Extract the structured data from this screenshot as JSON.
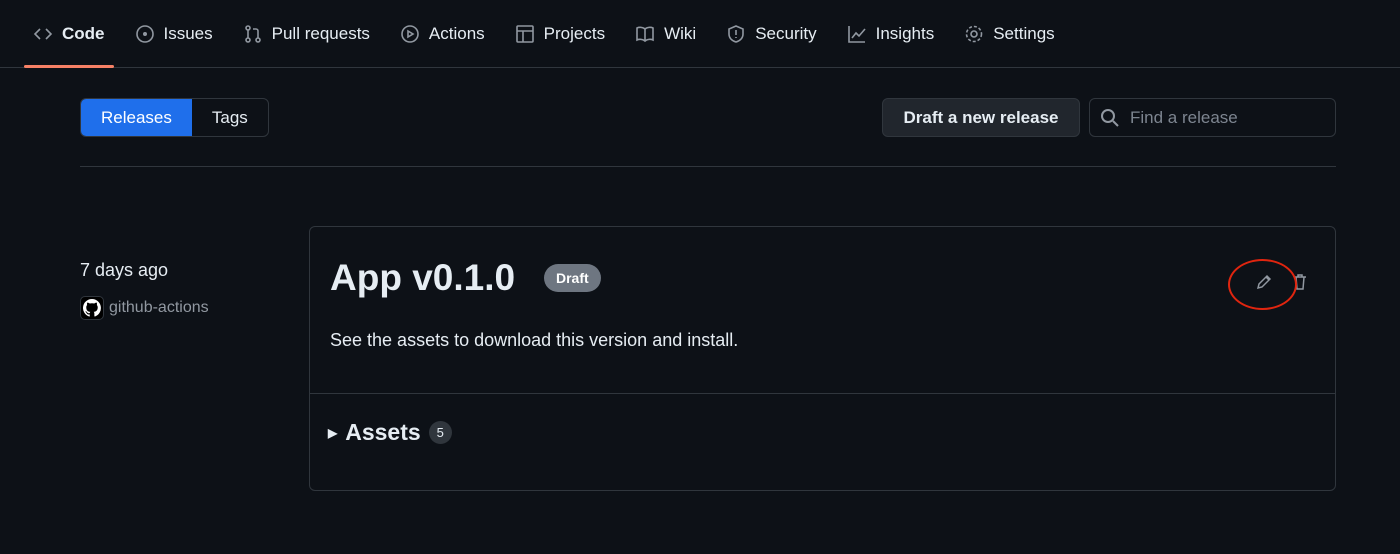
{
  "nav": {
    "tabs": [
      {
        "label": "Code",
        "icon": "code-icon"
      },
      {
        "label": "Issues",
        "icon": "issue-icon"
      },
      {
        "label": "Pull requests",
        "icon": "pull-request-icon"
      },
      {
        "label": "Actions",
        "icon": "play-icon"
      },
      {
        "label": "Projects",
        "icon": "table-icon"
      },
      {
        "label": "Wiki",
        "icon": "book-icon"
      },
      {
        "label": "Security",
        "icon": "shield-icon"
      },
      {
        "label": "Insights",
        "icon": "graph-icon"
      },
      {
        "label": "Settings",
        "icon": "gear-icon"
      }
    ]
  },
  "toolbar": {
    "releases": "Releases",
    "tags": "Tags",
    "draft": "Draft a new release",
    "search_placeholder": "Find a release"
  },
  "release": {
    "date": "7 days ago",
    "author": "github-actions",
    "title": "App v0.1.0",
    "badge": "Draft",
    "description": "See the assets to download this version and install.",
    "assets_label": "Assets",
    "assets_count": "5"
  },
  "colors": {
    "accent": "#1f6feb",
    "underline": "#f78166",
    "annotation": "#e0250f"
  }
}
